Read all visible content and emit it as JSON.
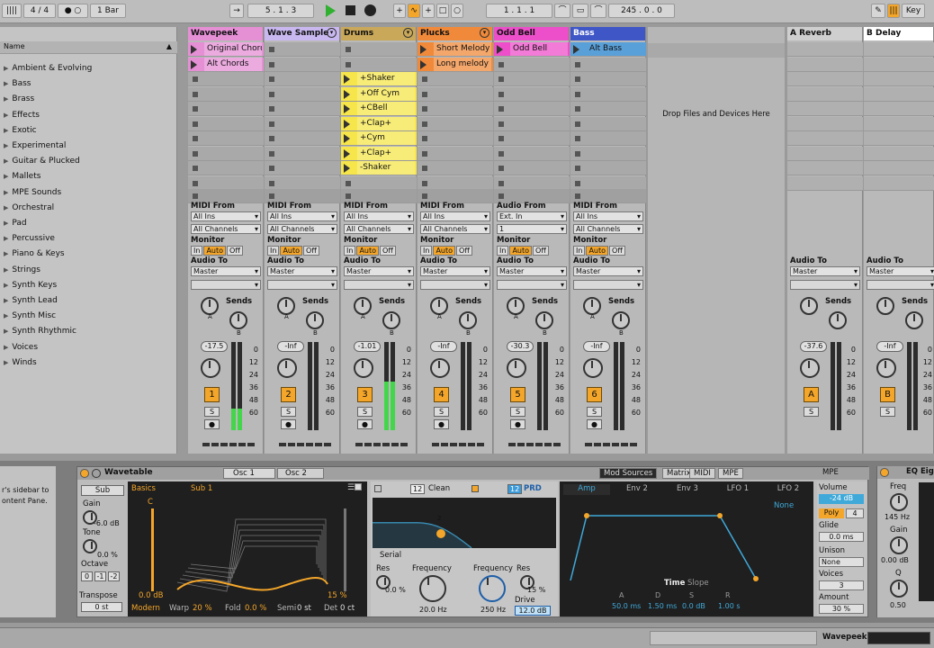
{
  "top": {
    "sig": "4 / 4",
    "quant": "1 Bar",
    "pos": "5 .  1 .  3",
    "loop_start": "1 .  1 .  1",
    "loop_len": "245 .  0 .  0",
    "key": "Key"
  },
  "browser": {
    "items": [
      "Ambient & Evolving",
      "Bass",
      "Brass",
      "Effects",
      "Exotic",
      "Experimental",
      "Guitar & Plucked",
      "Mallets",
      "MPE Sounds",
      "Orchestral",
      "Pad",
      "Percussive",
      "Piano & Keys",
      "Strings",
      "Synth Keys",
      "Synth Lead",
      "Synth Misc",
      "Synth Rhythmic",
      "Voices",
      "Winds"
    ]
  },
  "tracks": [
    {
      "name": "Wavepeek",
      "color": "#e58fd5",
      "clips": [
        {
          "row": 0,
          "name": "Original Chords",
          "color": "#e58fd5"
        },
        {
          "row": 1,
          "name": "Alt Chords",
          "color": "#e58fd5"
        }
      ],
      "io_label": "MIDI From",
      "from": "All Ins",
      "ch": "All Channels",
      "vol": "-17.5",
      "num": "1",
      "meter": 0.25
    },
    {
      "name": "Wave Sample",
      "color": "#c9b8f0",
      "clips": [],
      "io_label": "MIDI From",
      "from": "All Ins",
      "ch": "All Channels",
      "vol": "-Inf",
      "num": "2",
      "meter": 0
    },
    {
      "name": "Drums",
      "color": "#c9a85a",
      "clips": [
        {
          "row": 2,
          "name": "+Shaker",
          "color": "#f6e64b"
        },
        {
          "row": 3,
          "name": "+Off Cym",
          "color": "#f6e64b"
        },
        {
          "row": 4,
          "name": "+CBell",
          "color": "#f6e64b"
        },
        {
          "row": 5,
          "name": "+Clap+",
          "color": "#f6e64b"
        },
        {
          "row": 6,
          "name": "+Cym",
          "color": "#f6e64b"
        },
        {
          "row": 7,
          "name": "+Clap+",
          "color": "#f6e64b"
        },
        {
          "row": 8,
          "name": "-Shaker",
          "color": "#f6e64b"
        }
      ],
      "io_label": "MIDI From",
      "from": "All Ins",
      "ch": "All Channels",
      "vol": "-1.01",
      "num": "3",
      "meter": 0.55
    },
    {
      "name": "Plucks",
      "color": "#f08a3a",
      "clips": [
        {
          "row": 0,
          "name": "Short Melody",
          "color": "#f08a3a"
        },
        {
          "row": 1,
          "name": "Long melody",
          "color": "#f08a3a"
        }
      ],
      "io_label": "MIDI From",
      "from": "All Ins",
      "ch": "All Channels",
      "vol": "-Inf",
      "num": "4",
      "meter": 0
    },
    {
      "name": "Odd Bell",
      "color": "#ec4fc9",
      "clips": [
        {
          "row": 0,
          "name": "Odd Bell",
          "color": "#ec4fc9"
        }
      ],
      "io_label": "Audio From",
      "from": "Ext. In",
      "ch": "1",
      "vol": "-30.3",
      "num": "5",
      "meter": 0
    },
    {
      "name": "Bass",
      "color": "#3f56c7",
      "clips": [
        {
          "row": 0,
          "name": "Alt Bass",
          "color": "#5aa0d8"
        }
      ],
      "io_label": "MIDI From",
      "from": "All Ins",
      "ch": "All Channels",
      "vol": "-Inf",
      "num": "6",
      "meter": 0
    }
  ],
  "mixer": {
    "monitor": "Monitor",
    "in": "In",
    "auto": "Auto",
    "off": "Off",
    "audio_to": "Audio To",
    "master": "Master",
    "sends": "Sends",
    "scale": [
      "0",
      "12",
      "24",
      "36",
      "48",
      "60"
    ],
    "a": "A",
    "b": "B",
    "s": "S"
  },
  "drop_text": "Drop Files and Devices Here",
  "returns": [
    {
      "name": "A Reverb",
      "vol": "-37.6",
      "letter": "A"
    },
    {
      "name": "B Delay",
      "vol": "-Inf",
      "letter": "B"
    }
  ],
  "device": {
    "name": "Wavetable",
    "info1": "r's sidebar to",
    "info2": "ontent Pane.",
    "osc1": "Osc 1",
    "osc2": "Osc 2",
    "sub": "Sub",
    "gain": "Gain",
    "gain_val": "-6.0 dB",
    "tone": "Tone",
    "tone_val": "0.0 %",
    "octave": "Octave",
    "oct": [
      "0",
      "-1",
      "-2"
    ],
    "transpose": "Transpose",
    "transpose_val": "0 st",
    "basics": "Basics",
    "sub1": "Sub 1",
    "c": "C",
    "db": "0.0 dB",
    "pct15": "15 %",
    "modern": "Modern",
    "warp": "Warp",
    "warp_val": "20 %",
    "fold": "Fold",
    "fold_val": "0.0 %",
    "semi": "Semi",
    "semi_val": "0 st",
    "det": "Det",
    "det_val": "0 ct",
    "f1": "12",
    "clean": "Clean",
    "f2": "12",
    "prd": "PRD",
    "serial": "Serial",
    "res": "Res",
    "res_val": "0.0 %",
    "freq": "Frequency",
    "freq_val": "20.0 Hz",
    "freq2": "Frequency",
    "res2": "Res",
    "freq2_val": "250 Hz",
    "drive": "Drive",
    "drive_pct": "15 %",
    "drive_val": "12.0 dB",
    "filter_badge": "2",
    "mod_tabs": [
      "Mod Sources",
      "Matrix",
      "MIDI",
      "MPE"
    ],
    "env_tabs": [
      "Amp",
      "Env 2",
      "Env 3",
      "LFO 1",
      "LFO 2"
    ],
    "none": "None",
    "time": "Time",
    "slope": "Slope",
    "adsr_labels": [
      "A",
      "D",
      "S",
      "R"
    ],
    "adsr_vals": [
      "50.0 ms",
      "1.50 ms",
      "0.0 dB",
      "1.00 s"
    ],
    "mpe": "MPE",
    "volume": "Volume",
    "volume_val": "-24 dB",
    "poly": "Poly",
    "poly_n": "4",
    "glide": "Glide",
    "glide_val": "0.0 ms",
    "unison": "Unison",
    "unison_val": "None",
    "voices": "Voices",
    "voices_val": "3",
    "amount": "Amount",
    "amount_val": "30 %"
  },
  "eq": {
    "name": "EQ Eigh",
    "freq": "Freq",
    "freq_val": "145 Hz",
    "gain": "Gain",
    "gain_val": "0.00 dB",
    "q": "Q",
    "q_val": "0.50"
  },
  "status": {
    "track": "Wavepeek"
  }
}
